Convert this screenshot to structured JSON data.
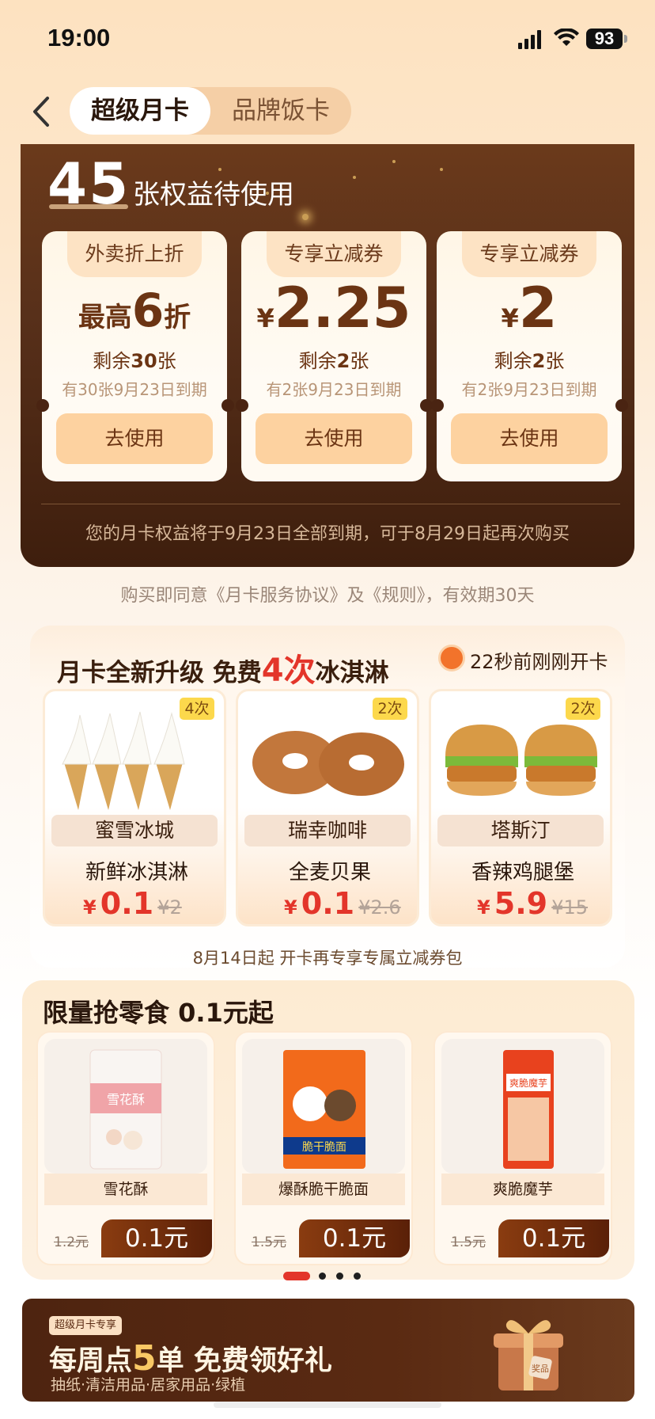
{
  "status_bar": {
    "time": "19:00",
    "battery": "93"
  },
  "tabs": {
    "active": "超级月卡",
    "inactive": "品牌饭卡"
  },
  "benefits": {
    "count": "45",
    "count_label": "张权益待使用",
    "coupons": [
      {
        "tag": "外卖折上折",
        "prefix": "最高",
        "value": "6",
        "suffix": "折",
        "remaining": "剩余",
        "remaining_num": "30",
        "remaining_unit": "张",
        "expiry": "有30张9月23日到期",
        "button": "去使用"
      },
      {
        "tag": "专享立减券",
        "prefix": "¥",
        "value": "2.25",
        "suffix": "",
        "remaining": "剩余",
        "remaining_num": "2",
        "remaining_unit": "张",
        "expiry": "有2张9月23日到期",
        "button": "去使用"
      },
      {
        "tag": "专享立减券",
        "prefix": "¥",
        "value": "2",
        "suffix": "",
        "remaining": "剩余",
        "remaining_num": "2",
        "remaining_unit": "张",
        "expiry": "有2张9月23日到期",
        "button": "去使用"
      }
    ],
    "footer": "您的月卡权益将于9月23日全部到期，可于8月29日起再次购买"
  },
  "agreement": "购买即同意《月卡服务协议》及《规则》，有效期30天",
  "icecream": {
    "title_a": "月卡全新升级 免费",
    "title_red": "4次",
    "title_b": "冰淇淋",
    "recent": "22秒前刚刚开卡",
    "items": [
      {
        "times": "4次",
        "brand": "蜜雪冰城",
        "name": "新鲜冰淇淋",
        "currency": "¥",
        "price": "0.1",
        "old": "¥2",
        "image": "ice-cream-cones"
      },
      {
        "times": "2次",
        "brand": "瑞幸咖啡",
        "name": "全麦贝果",
        "currency": "¥",
        "price": "0.1",
        "old": "¥2.6",
        "image": "bagels"
      },
      {
        "times": "2次",
        "brand": "塔斯汀",
        "name": "香辣鸡腿堡",
        "currency": "¥",
        "price": "5.9",
        "old": "¥15",
        "image": "chicken-burgers"
      }
    ],
    "footer": "8月14日起 开卡再专享专属立减券包"
  },
  "snacks": {
    "title": "限量抢零食 0.1元起",
    "items": [
      {
        "name": "雪花酥",
        "old": "1.2元",
        "price": "0.1元",
        "pkg_text": "雪花酥"
      },
      {
        "name": "爆酥脆干脆面",
        "old": "1.5元",
        "price": "0.1元",
        "pkg_text": "脆干脆面"
      },
      {
        "name": "爽脆魔芋",
        "old": "1.5元",
        "price": "0.1元",
        "pkg_text": "爽脆魔芋"
      }
    ]
  },
  "banner": {
    "tag": "超级月卡专享",
    "title_a": "每周点",
    "title_num": "5",
    "title_b": "单 免费领好礼",
    "subtitle": "抽纸·清洁用品·居家用品·绿植",
    "gift_label": "奖品"
  },
  "colors": {
    "accent_red": "#e3352a",
    "brown_dark": "#58301a",
    "tan": "#fdd2a0"
  }
}
